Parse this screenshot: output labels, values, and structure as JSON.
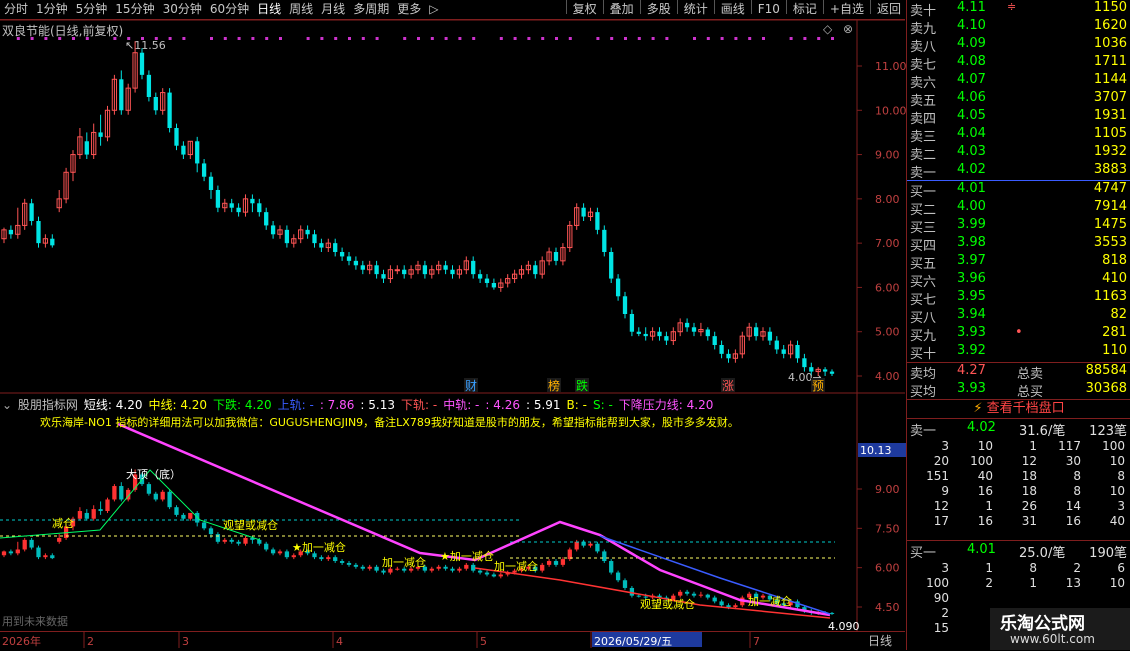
{
  "toolbar": {
    "periods": [
      "分时",
      "1分钟",
      "5分钟",
      "15分钟",
      "30分钟",
      "60分钟",
      "日线",
      "周线",
      "月线",
      "多周期",
      "更多"
    ],
    "active": "日线",
    "more_arrow": "▷",
    "tools": [
      "复权",
      "叠加",
      "多股",
      "统计",
      "画线",
      "F10",
      "标记",
      "+自选",
      "返回"
    ]
  },
  "main_chart": {
    "title": "双良节能(日线,前复权)",
    "y_ticks": [
      "11.00",
      "10.00",
      "9.00",
      "8.00",
      "7.00",
      "6.00",
      "5.00",
      "4.00"
    ],
    "high_label": "11.56",
    "low_label": "4.00",
    "event_markers": [
      {
        "text": "财",
        "color": "#3aa0ff"
      },
      {
        "text": "榜",
        "color": "#ffb000"
      },
      {
        "text": "跌",
        "color": "#00ff00"
      },
      {
        "text": "涨",
        "color": "#ff5555"
      },
      {
        "text": "预",
        "color": "#ffb000"
      }
    ],
    "diamond_icon": "diamond-icon",
    "close_icon": "close-icon"
  },
  "sub_chart": {
    "name": "股朋指标网",
    "params": [
      {
        "text": "短线: 4.20",
        "color": "#ffffff"
      },
      {
        "text": "中线: 4.20",
        "color": "#ffff00"
      },
      {
        "text": "下跌: 4.20",
        "color": "#00ff00"
      },
      {
        "text": "上轨: -",
        "color": "#3a5cff"
      },
      {
        "text": ": 7.86",
        "color": "#ff55ff"
      },
      {
        "text": ": 5.13",
        "color": "#ffffff"
      },
      {
        "text": "下轨: -",
        "color": "#ff5555"
      },
      {
        "text": "中轨: -",
        "color": "#ff55ff"
      },
      {
        "text": ": 4.26",
        "color": "#ff55ff"
      },
      {
        "text": ": 5.91",
        "color": "#ffffff"
      },
      {
        "text": "B: -",
        "color": "#ffff00"
      },
      {
        "text": "S: -",
        "color": "#00ff00"
      },
      {
        "text": "下降压力线: 4.20",
        "color": "#ff55ff"
      }
    ],
    "note": "欢乐海岸-NO1 指标的详细用法可以加我微信：GUGUSHENGJIN9，备注LX789我好知道是股市的朋友，希望指标能帮到大家，股市多多发财。",
    "y_ticks": [
      "9.00",
      "7.50",
      "6.00",
      "4.50"
    ],
    "cursor_value": "10.13",
    "last_value": "4.090",
    "labels": [
      "大顶（底）",
      "减仓",
      "观望或减仓",
      "★加一减仓",
      "加一减仓",
      "★加一减仓",
      "加一减仓",
      "观望或减仓",
      "加一减仓"
    ],
    "future_label": "用到未来数据"
  },
  "date_axis": {
    "labels": [
      "2026年",
      "2",
      "3",
      "4",
      "5",
      "2026/05/29/五",
      "7"
    ],
    "period": "日线"
  },
  "order_book": {
    "asks": [
      {
        "label": "卖十",
        "price": "4.11",
        "vol": "1150",
        "mark": "≑"
      },
      {
        "label": "卖九",
        "price": "4.10",
        "vol": "1620"
      },
      {
        "label": "卖八",
        "price": "4.09",
        "vol": "1036"
      },
      {
        "label": "卖七",
        "price": "4.08",
        "vol": "1711"
      },
      {
        "label": "卖六",
        "price": "4.07",
        "vol": "1144"
      },
      {
        "label": "卖五",
        "price": "4.06",
        "vol": "3707"
      },
      {
        "label": "卖四",
        "price": "4.05",
        "vol": "1931"
      },
      {
        "label": "卖三",
        "price": "4.04",
        "vol": "1105"
      },
      {
        "label": "卖二",
        "price": "4.03",
        "vol": "1932"
      },
      {
        "label": "卖一",
        "price": "4.02",
        "vol": "3883"
      }
    ],
    "bids": [
      {
        "label": "买一",
        "price": "4.01",
        "vol": "4747"
      },
      {
        "label": "买二",
        "price": "4.00",
        "vol": "7914"
      },
      {
        "label": "买三",
        "price": "3.99",
        "vol": "1475"
      },
      {
        "label": "买四",
        "price": "3.98",
        "vol": "3553"
      },
      {
        "label": "买五",
        "price": "3.97",
        "vol": "818"
      },
      {
        "label": "买六",
        "price": "3.96",
        "vol": "410"
      },
      {
        "label": "买七",
        "price": "3.95",
        "vol": "1163"
      },
      {
        "label": "买八",
        "price": "3.94",
        "vol": "82"
      },
      {
        "label": "买九",
        "price": "3.93",
        "vol": "281",
        "mark": "•"
      },
      {
        "label": "买十",
        "price": "3.92",
        "vol": "110"
      }
    ],
    "avg_ask_label": "卖均",
    "avg_ask": "4.27",
    "total_ask_label": "总卖",
    "total_ask": "88584",
    "avg_bid_label": "买均",
    "avg_bid": "3.93",
    "total_bid_label": "总买",
    "total_bid": "30368",
    "level1000_button": "查看千档盘口",
    "sell1": {
      "label": "卖一",
      "price": "4.02",
      "per": "31.6/笔",
      "count": "123笔"
    },
    "sell1_grid": [
      [
        "3",
        "10",
        "1",
        "117",
        "100"
      ],
      [
        "20",
        "100",
        "12",
        "30",
        "10"
      ],
      [
        "151",
        "40",
        "18",
        "8",
        "8"
      ],
      [
        "9",
        "16",
        "18",
        "8",
        "10"
      ],
      [
        "12",
        "1",
        "26",
        "14",
        "3"
      ],
      [
        "17",
        "16",
        "31",
        "16",
        "40"
      ]
    ],
    "buy1": {
      "label": "买一",
      "price": "4.01",
      "per": "25.0/笔",
      "count": "190笔"
    },
    "buy1_grid": [
      [
        "3",
        "1",
        "8",
        "2",
        "6"
      ],
      [
        "100",
        "2",
        "1",
        "13",
        "10"
      ],
      [
        "90",
        "",
        "",
        "",
        ""
      ],
      [
        "2",
        "",
        "",
        "",
        ""
      ],
      [
        "15",
        "",
        "",
        "",
        ""
      ]
    ]
  },
  "watermark": {
    "title": "乐淘公式网",
    "url": "www.60lt.com"
  },
  "colors": {
    "up": "#ff5555",
    "down": "#00e5e5",
    "pink": "#ff44ff",
    "yellow": "#ffff00",
    "green": "#00ff00",
    "border": "#7f1e1e"
  }
}
